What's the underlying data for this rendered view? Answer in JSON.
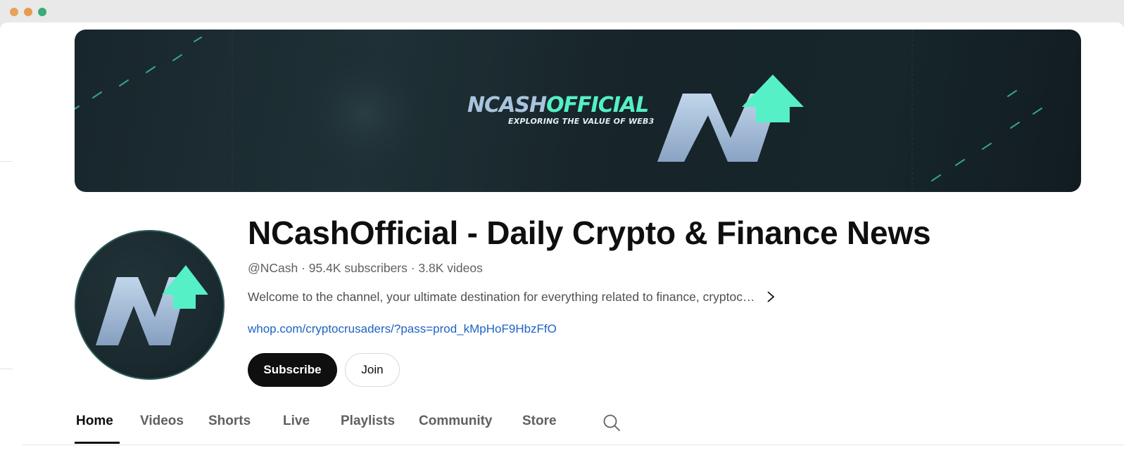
{
  "window": {
    "controls": [
      "close",
      "minimize",
      "maximize"
    ]
  },
  "banner": {
    "title_part1": "NCASH",
    "title_part2": "OFFICIAL",
    "subtitle": "EXPLORING THE VALUE OF WEB3",
    "colors": {
      "accent": "#55f0c5",
      "logo": "#a9c4dd",
      "background": "#18262c"
    }
  },
  "channel": {
    "name": "NCashOfficial - Daily Crypto & Finance News",
    "meta": "@NCash · 95.4K subscribers · 3.8K videos",
    "description": "Welcome to the channel, your ultimate destination for everything related to finance, cryptoc…",
    "link": "whop.com/cryptocrusaders/?pass=prod_kMpHoF9HbzFfO"
  },
  "actions": {
    "subscribe_label": "Subscribe",
    "join_label": "Join"
  },
  "tabs": [
    {
      "label": "Home",
      "active": true
    },
    {
      "label": "Videos"
    },
    {
      "label": "Shorts"
    },
    {
      "label": "Live"
    },
    {
      "label": "Playlists"
    },
    {
      "label": "Community"
    },
    {
      "label": "Store"
    }
  ],
  "icons": {
    "expand_description": "chevron-right-icon",
    "search": "search-icon"
  }
}
